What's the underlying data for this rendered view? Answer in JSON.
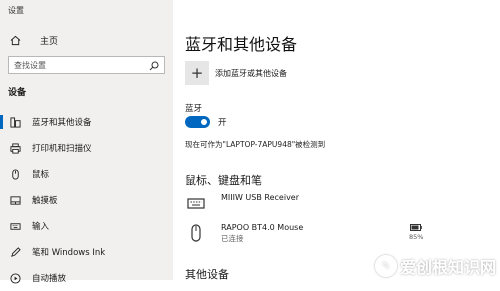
{
  "window": {
    "title": "设置"
  },
  "sidebar": {
    "home_label": "主页",
    "search_placeholder": "查找设置",
    "section_label": "设备",
    "items": [
      {
        "label": "蓝牙和其他设备",
        "icon": "bluetooth-devices-icon",
        "active": true
      },
      {
        "label": "打印机和扫描仪",
        "icon": "printer-icon"
      },
      {
        "label": "鼠标",
        "icon": "mouse-icon"
      },
      {
        "label": "触摸板",
        "icon": "touchpad-icon"
      },
      {
        "label": "输入",
        "icon": "keyboard-icon"
      },
      {
        "label": "笔和 Windows Ink",
        "icon": "pen-icon"
      },
      {
        "label": "自动播放",
        "icon": "autoplay-icon"
      }
    ]
  },
  "main": {
    "title": "蓝牙和其他设备",
    "add_device_label": "添加蓝牙或其他设备",
    "bluetooth_label": "蓝牙",
    "toggle_state": "开",
    "discoverable_text": "现在可作为\"LAPTOP-7APU948\"被检测到",
    "mouse_kb_pen_heading": "鼠标、键盘和笔",
    "devices": [
      {
        "name": "MIIIW USB Receiver",
        "status": "",
        "icon": "keyboard-icon"
      },
      {
        "name": "RAPOO BT4.0 Mouse",
        "status": "已连接",
        "icon": "mouse-icon",
        "battery": "85%"
      }
    ],
    "other_devices_heading": "其他设备"
  },
  "watermark": {
    "text": "爱创根知识网"
  },
  "colors": {
    "accent": "#0067c0",
    "sidebar_bg": "#f2f0ee"
  }
}
